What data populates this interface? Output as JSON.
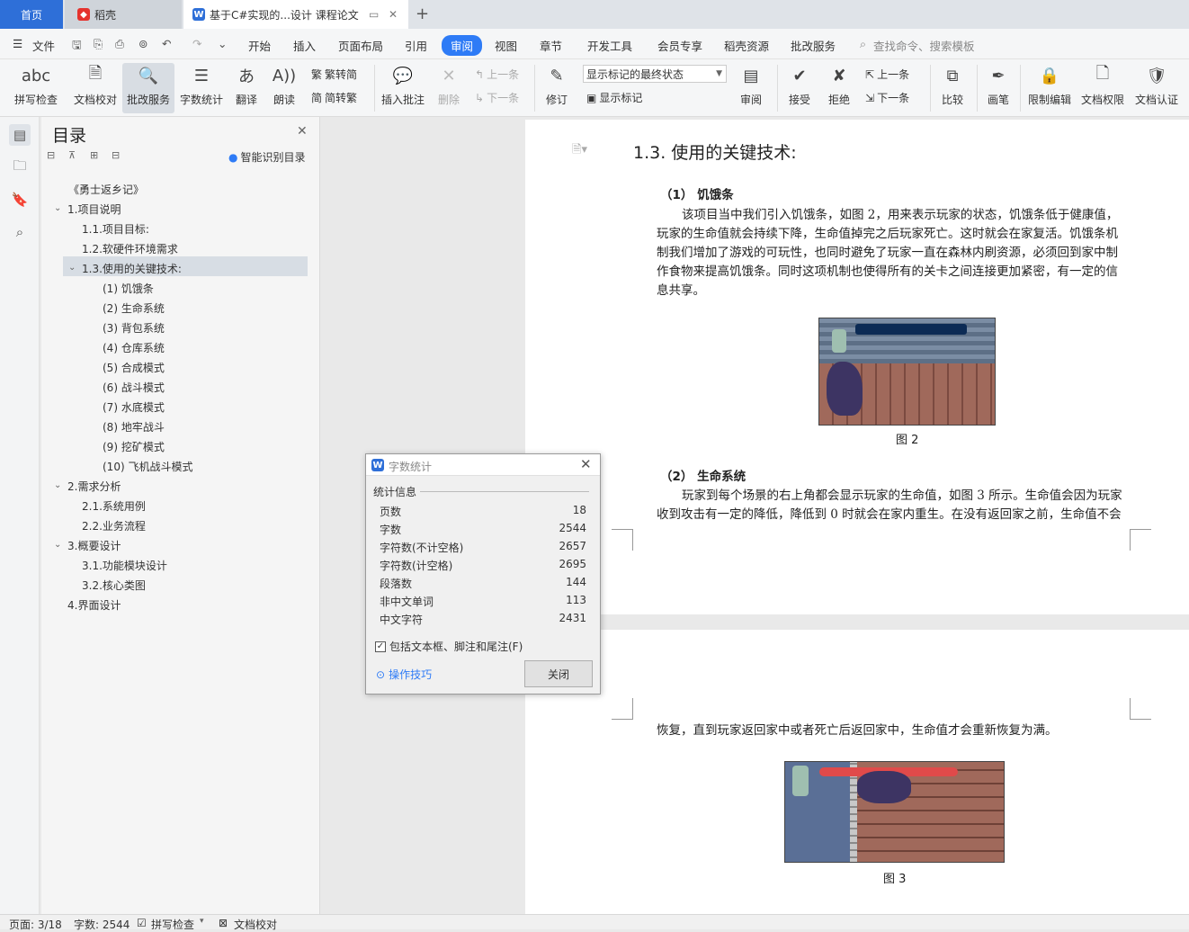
{
  "tabs": {
    "home": "首页",
    "daoke": "稻壳",
    "doc": "基于C#实现的...设计 课程论文"
  },
  "menubar": {
    "file": "文件",
    "items": [
      "开始",
      "插入",
      "页面布局",
      "引用",
      "审阅",
      "视图",
      "章节",
      "开发工具",
      "会员专享",
      "稻壳资源",
      "批改服务"
    ],
    "search": "查找命令、搜索模板"
  },
  "ribbon": {
    "spell": "拼写检查",
    "proof": "文档校对",
    "correct": "批改服务",
    "wordcount": "字数统计",
    "translate": "翻译",
    "read": "朗读",
    "trad": "繁转简",
    "simp": "简转繁",
    "insert_comment": "插入批注",
    "delete": "删除",
    "prev": "上一条",
    "next": "下一条",
    "revise": "修订",
    "markup_state": "显示标记的最终状态",
    "show_markup": "显示标记",
    "review": "审阅",
    "accept": "接受",
    "reject": "拒绝",
    "prev2": "上一条",
    "next2": "下一条",
    "compare": "比较",
    "ink": "画笔",
    "restrict": "限制编辑",
    "permission": "文档权限",
    "certify": "文档认证"
  },
  "outline": {
    "title": "目录",
    "smart": "智能识别目录",
    "items": [
      "《勇士返乡记》",
      "1.项目说明",
      "1.1.项目目标:",
      "1.2.软硬件环境需求",
      "1.3.使用的关键技术:",
      "(1)  饥饿条",
      "(2)  生命系统",
      "(3)  背包系统",
      "(4)  仓库系统",
      "(5)  合成模式",
      "(6)  战斗模式",
      "(7)  水底模式",
      "(8)  地牢战斗",
      "(9)  挖矿模式",
      "(10)  飞机战斗模式",
      "2.需求分析",
      "2.1.系统用例",
      "2.2.业务流程",
      "3.概要设计",
      "3.1.功能模块设计",
      "3.2.核心类图",
      "4.界面设计"
    ]
  },
  "doc": {
    "heading": "1.3. 使用的关键技术:",
    "s1_title": "（1）   饥饿条",
    "s1_lines": [
      "该项目当中我们引入饥饿条，如图 2，用来表示玩家的状态，饥饿条低于健康值，",
      "玩家的生命值就会持续下降，生命值掉完之后玩家死亡。这时就会在家复活。饥饿条机",
      "制我们增加了游戏的可玩性，也同时避免了玩家一直在森林内刷资源，必须回到家中制",
      "作食物来提高饥饿条。同时这项机制也使得所有的关卡之间连接更加紧密，有一定的信",
      "息共享。"
    ],
    "fig2": "图 2",
    "s2_title": "（2）   生命系统",
    "s2_lines": [
      "玩家到每个场景的右上角都会显示玩家的生命值，如图 3 所示。生命值会因为玩家",
      "收到攻击有一定的降低，降低到 0 时就会在家内重生。在没有返回家之前，生命值不会"
    ],
    "p2_line": "恢复，直到玩家返回家中或者死亡后返回家中，生命值才会重新恢复为满。",
    "fig3": "图 3"
  },
  "dialog": {
    "title": "字数统计",
    "section": "统计信息",
    "rows": [
      {
        "label": "页数",
        "value": "18"
      },
      {
        "label": "字数",
        "value": "2544"
      },
      {
        "label": "字符数(不计空格)",
        "value": "2657"
      },
      {
        "label": "字符数(计空格)",
        "value": "2695"
      },
      {
        "label": "段落数",
        "value": "144"
      },
      {
        "label": "非中文单词",
        "value": "113"
      },
      {
        "label": "中文字符",
        "value": "2431"
      }
    ],
    "include": "包括文本框、脚注和尾注(F)",
    "tips": "操作技巧",
    "close": "关闭"
  },
  "status": {
    "page": "页面: 3/18",
    "words": "字数: 2544",
    "spell": "拼写检查",
    "proof": "文档校对"
  },
  "colors": {
    "accent": "#2e7bf6",
    "home_tab": "#2e6fd8"
  }
}
